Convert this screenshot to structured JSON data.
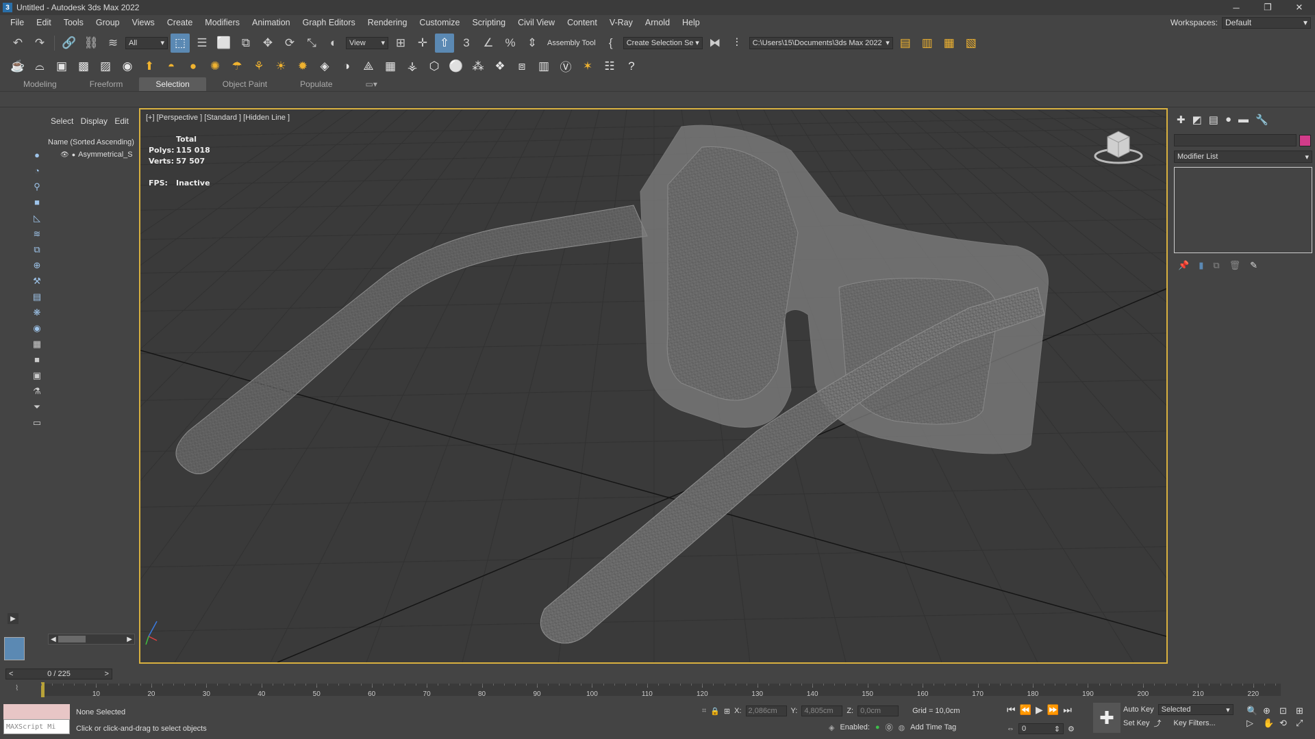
{
  "app": {
    "title": "Untitled - Autodesk 3ds Max 2022",
    "logo": "3"
  },
  "window_controls": {
    "minimize": "─",
    "restore": "❐",
    "close": "✕"
  },
  "menu": [
    "File",
    "Edit",
    "Tools",
    "Group",
    "Views",
    "Create",
    "Modifiers",
    "Animation",
    "Graph Editors",
    "Rendering",
    "Customize",
    "Scripting",
    "Civil View",
    "Content",
    "V-Ray",
    "Arnold",
    "Help"
  ],
  "workspace": {
    "label": "Workspaces:",
    "value": "Default"
  },
  "toolbar": {
    "filter": "All",
    "ref_coord": "View",
    "assembly_tool": "Assembly Tool",
    "selection_set": "Create Selection Se",
    "project_path": "C:\\Users\\15\\Documents\\3ds Max 2022"
  },
  "ribbon_tabs": [
    "Modeling",
    "Freeform",
    "Selection",
    "Object Paint",
    "Populate"
  ],
  "explorer": {
    "tabs": [
      "Select",
      "Display",
      "Edit"
    ],
    "header": "Name (Sorted Ascending)",
    "items": [
      "Asymmetrical_S"
    ]
  },
  "viewport": {
    "label": "[+] [Perspective ] [Standard ] [Hidden Line ]",
    "stats": {
      "total_label": "Total",
      "polys_label": "Polys:",
      "polys": "115 018",
      "verts_label": "Verts:",
      "verts": "57 507",
      "fps_label": "FPS:",
      "fps": "Inactive"
    }
  },
  "command_panel": {
    "modifier_list": "Modifier List",
    "color_swatch": "#d23c8a"
  },
  "timeline": {
    "frame": "0 / 225",
    "ticks": [
      10,
      20,
      30,
      40,
      50,
      60,
      70,
      80,
      90,
      100,
      110,
      120,
      130,
      140,
      150,
      160,
      170,
      180,
      190,
      200,
      210,
      220
    ],
    "max": 225
  },
  "status": {
    "maxscript": "MAXScript Mi",
    "selection": "None Selected",
    "prompt": "Click or click-and-drag to select objects",
    "x_label": "X:",
    "x": "2,086cm",
    "y_label": "Y:",
    "y": "4,805cm",
    "z_label": "Z:",
    "z": "0,0cm",
    "grid": "Grid = 10,0cm",
    "enabled_label": "Enabled:",
    "add_time_tag": "Add Time Tag",
    "current_frame": "0"
  },
  "keys": {
    "auto_key": "Auto Key",
    "set_key": "Set Key",
    "selected": "Selected",
    "key_filters": "Key Filters..."
  },
  "colors": {
    "accent": "#5b89b3",
    "viewport_border": "#d9b13f",
    "icon_yellow": "#f0b330"
  }
}
